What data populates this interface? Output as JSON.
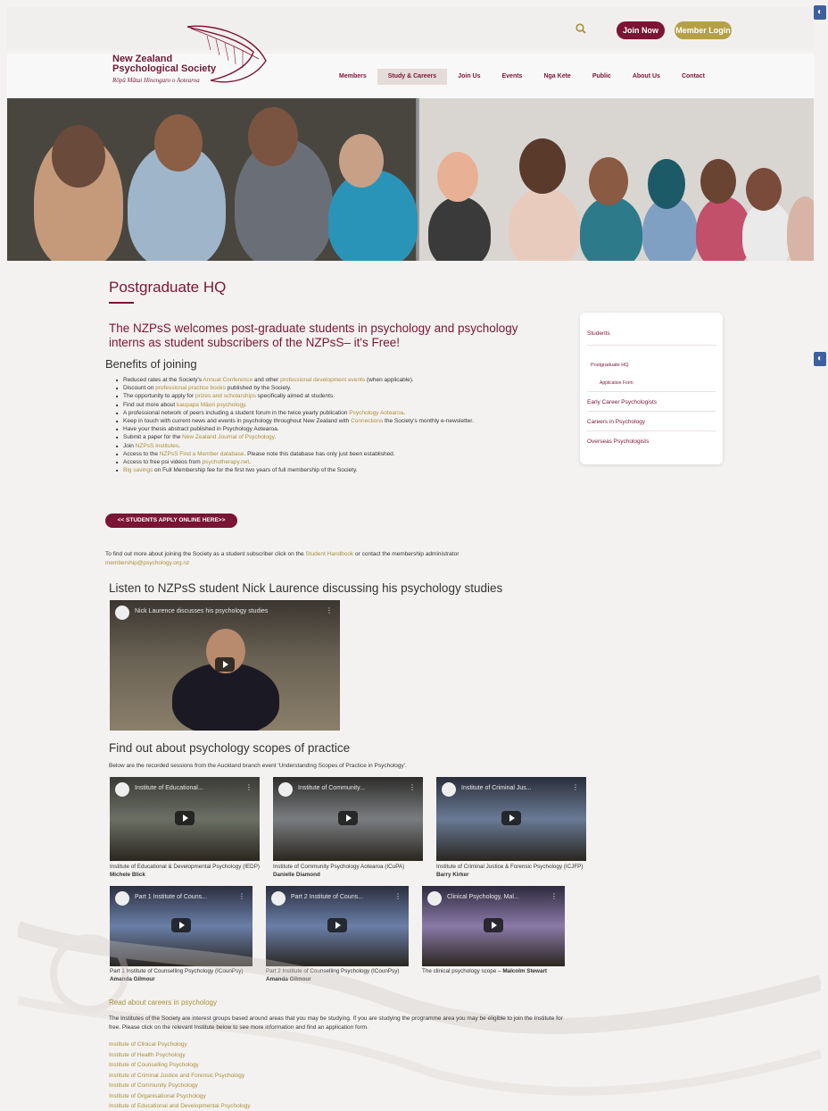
{
  "topbar": {
    "join_label": "Join Now",
    "login_label": "Member Login"
  },
  "logo": {
    "line1": "New Zealand",
    "line2": "Psychological Society",
    "line3": "Rōpū Mātai Hinengaro o Aotearoa"
  },
  "nav": [
    "Members",
    "Study & Careers",
    "Join Us",
    "Events",
    "Nga Kete",
    "Public",
    "About Us",
    "Contact"
  ],
  "page": {
    "title": "Postgraduate HQ",
    "intro": "The NZPsS welcomes post-graduate students in psychology and psychology interns as student subscribers of the NZPsS– it's Free!",
    "benefits_heading": "Benefits of joining",
    "benefits": [
      [
        "Reduced rates at the Society's ",
        "Annual Conference",
        " and other ",
        "professional development events",
        " (when applicable)."
      ],
      [
        "Discount on ",
        "professional practice books",
        " published by the Society.",
        "",
        ""
      ],
      [
        "The opportunity to apply for ",
        "prizes and scholarships",
        " specifically aimed at students.",
        "",
        ""
      ],
      [
        "Find out more about ",
        "kaupapa Māori psychology",
        ".",
        "",
        ""
      ],
      [
        "A professional network of peers including a student forum in the twice yearly publication ",
        "Psychology Aotearoa",
        ".",
        "",
        ""
      ],
      [
        "Keep in touch with current news and events in psychology throughout New Zealand with ",
        "Connections",
        " the Society's monthly e-newsletter.",
        "",
        ""
      ],
      [
        "Have your thesis abstract published in Psychology Aotearoa.",
        "",
        "",
        "",
        ""
      ],
      [
        "Submit a paper for the ",
        "New Zealand Journal of Psychology",
        ".",
        "",
        ""
      ],
      [
        "Join ",
        "NZPsS Institutes",
        ".",
        "",
        ""
      ],
      [
        "Access to the ",
        "NZPsS Find a Member database",
        ". Please note this database has only just been established.",
        "",
        ""
      ],
      [
        "Access to free psi videos from ",
        "psychotherapy.net",
        ".",
        "",
        ""
      ],
      [
        "",
        "Big savings",
        " on Full Membership fee for the first two years of full membership of the Society.",
        "",
        ""
      ]
    ],
    "apply_label": "<< STUDENTS APPLY ONLINE HERE>>",
    "find_more_pre": "To find out more about joining the Society as a student subscriber click on the ",
    "find_more_link1": "Student Handbook",
    "find_more_mid": " or contact the membership administrator ",
    "find_more_link2": "membership@psychology.org.nz",
    "listen_heading": "Listen to NZPsS student Nick Laurence discussing his psychology studies",
    "main_video_title": "Nick Laurence discusses his psychology studies",
    "scopes_heading": "Find out about psychology scopes of practice",
    "scopes_sub": "Below are the recorded sessions from the Auckland branch event 'Understanding Scopes of Practice in Psychology'.",
    "videos": [
      {
        "title": "Institute of Educational...",
        "cap": "Institute of Educational & Developmental Psychology (IEDP) ",
        "name": "Michele Blick"
      },
      {
        "title": "Institute of Community...",
        "cap": "Institute of Community Psychology Aotearoa (ICuPA) ",
        "name": "Danielle Diamond"
      },
      {
        "title": "Institute of Criminal Jus...",
        "cap": "Institute of Criminal Justice & Forensic Psychology (ICJFP) ",
        "name": "Barry Kirker"
      },
      {
        "title": "Part 1 Institute of Couns...",
        "cap": "Part 1 Institute of Counselling Psychology (ICounPsy) ",
        "name": "Amanda Gilmour"
      },
      {
        "title": "Part 2 Institute of Couns...",
        "cap": "Part 2 Institute of Counselling Psychology (ICounPsy) ",
        "name": "Amanda Gilmour"
      },
      {
        "title": "Clinical Psychology, Mal...",
        "cap": "The clinical psychology scope – ",
        "name": "Malcolm Stewart"
      }
    ],
    "careers_link": "Read about careers in psychology",
    "institutes_p": "The Institutes of the Society are interest groups based around areas that you may be studying. If you are studying the programme area you may be eligible to join the Institute for free. Please click on the relevant Institute below to see more information and find an application form.",
    "institutes": [
      "Institute of Clinical Psychology",
      "Institute of Health Psychology",
      "Institute of Counselling Psychology",
      "Institute of Criminal Justice and Forensic Psychology",
      "Institute of Community Psychology",
      "Institute of Organisational Psychology",
      "Institute of Educational and Developmental Psychology"
    ]
  },
  "sidebar": {
    "items": [
      "Students",
      "Postgraduate HQ",
      "Application Form",
      "Early Career Psychologists",
      "Careers in Psychology",
      "Overseas Psychologists"
    ]
  },
  "colors": {
    "brand": "#7a1535",
    "gold": "#b5a046",
    "link": "#a88f3a"
  }
}
